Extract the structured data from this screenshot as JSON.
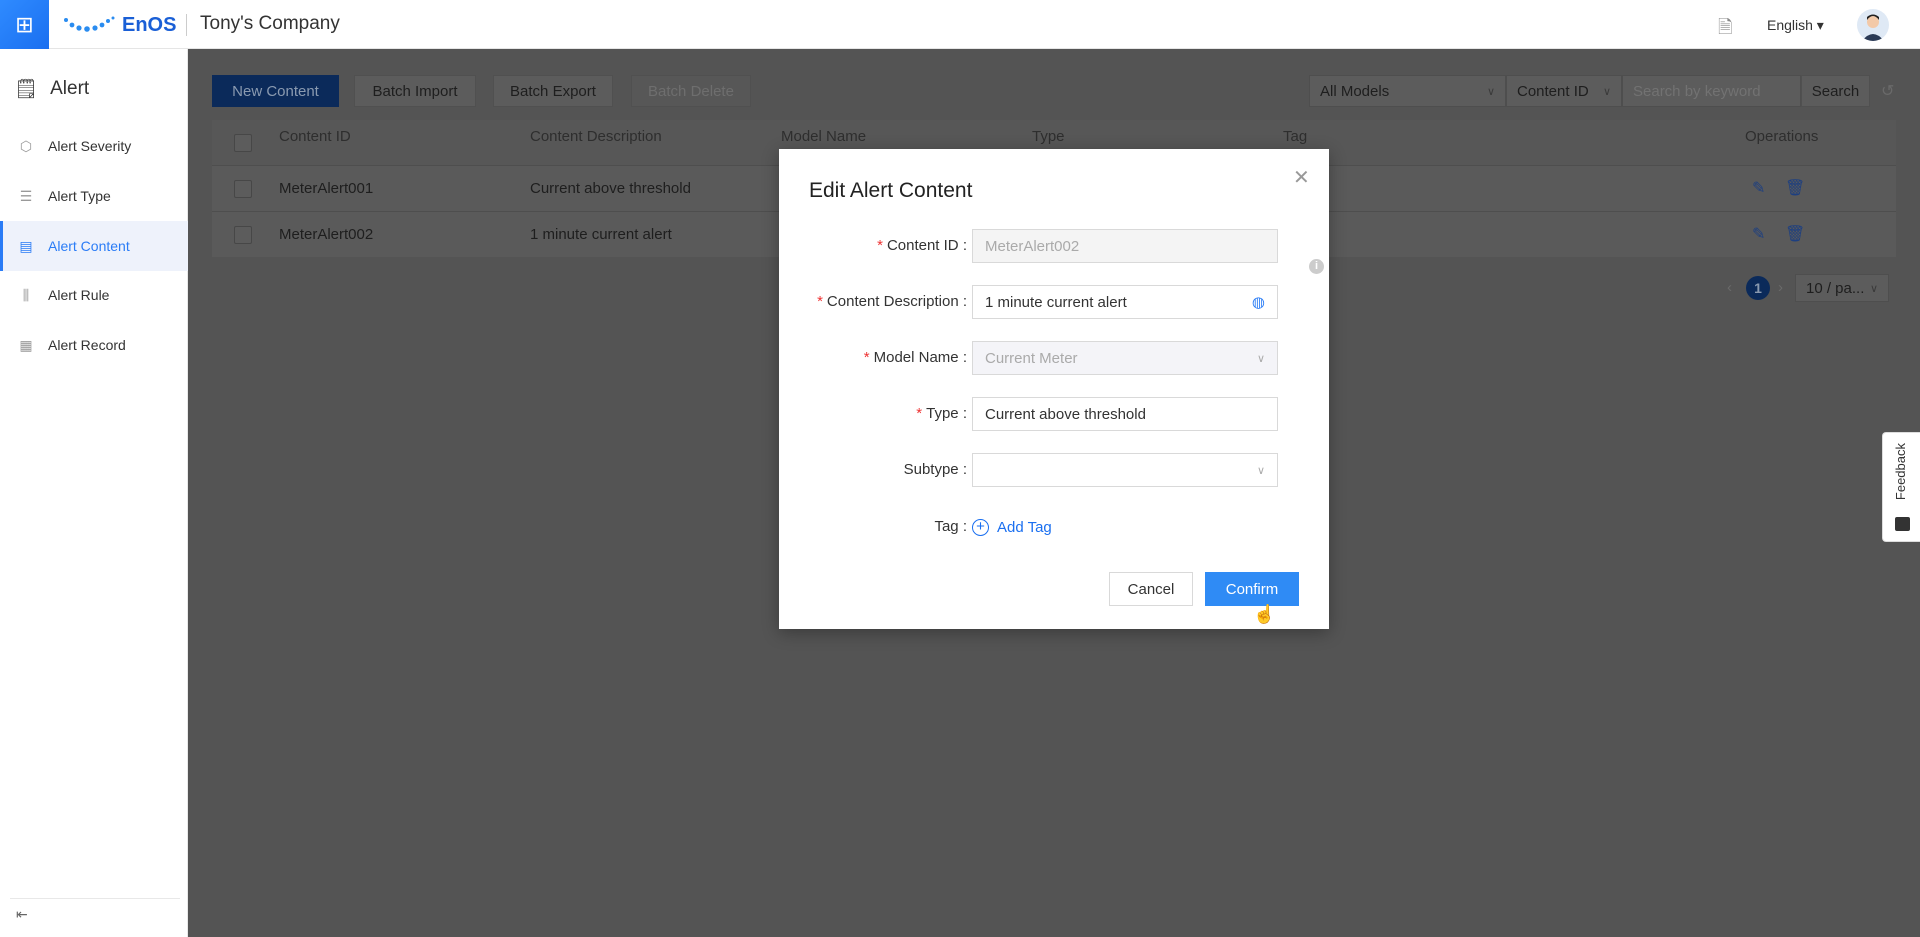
{
  "header": {
    "brand": "EnOS",
    "company": "Tony's Company",
    "language": "English",
    "icons": {
      "apps": "app-grid-icon",
      "docs": "document-icon",
      "user": "avatar"
    }
  },
  "sidebar": {
    "title": "Alert",
    "items": [
      {
        "label": "Alert Severity",
        "icon": "hexagon-icon"
      },
      {
        "label": "Alert Type",
        "icon": "list-icon"
      },
      {
        "label": "Alert Content",
        "icon": "clipboard-icon",
        "active": true
      },
      {
        "label": "Alert Rule",
        "icon": "sliders-icon"
      },
      {
        "label": "Alert Record",
        "icon": "record-icon"
      }
    ]
  },
  "toolbar": {
    "new": "New Content",
    "import": "Batch Import",
    "export": "Batch Export",
    "delete": "Batch Delete",
    "model_filter": "All Models",
    "field_filter": "Content ID",
    "search_placeholder": "Search by keyword",
    "search": "Search"
  },
  "table": {
    "columns": [
      "Content ID",
      "Content Description",
      "Model Name",
      "Type",
      "Tag",
      "Operations"
    ],
    "rows": [
      {
        "id": "MeterAlert001",
        "desc": "Current above threshold"
      },
      {
        "id": "MeterAlert002",
        "desc": "1 minute current alert"
      }
    ]
  },
  "pagination": {
    "current": "1",
    "page_size": "10 / pa..."
  },
  "feedback": "Feedback",
  "modal": {
    "title": "Edit Alert Content",
    "fields": {
      "content_id": {
        "label": "Content ID",
        "value": "MeterAlert002"
      },
      "description": {
        "label": "Content Description",
        "value": "1 minute current alert"
      },
      "model": {
        "label": "Model Name",
        "value": "Current Meter"
      },
      "type": {
        "label": "Type",
        "value": "Current above threshold"
      },
      "subtype": {
        "label": "Subtype",
        "value": ""
      },
      "tag": {
        "label": "Tag"
      }
    },
    "add_tag": "Add Tag",
    "cancel": "Cancel",
    "confirm": "Confirm",
    "colon": ":"
  },
  "colors": {
    "primary": "#1565e0",
    "confirm": "#2f8bf5",
    "required": "#e33333"
  }
}
